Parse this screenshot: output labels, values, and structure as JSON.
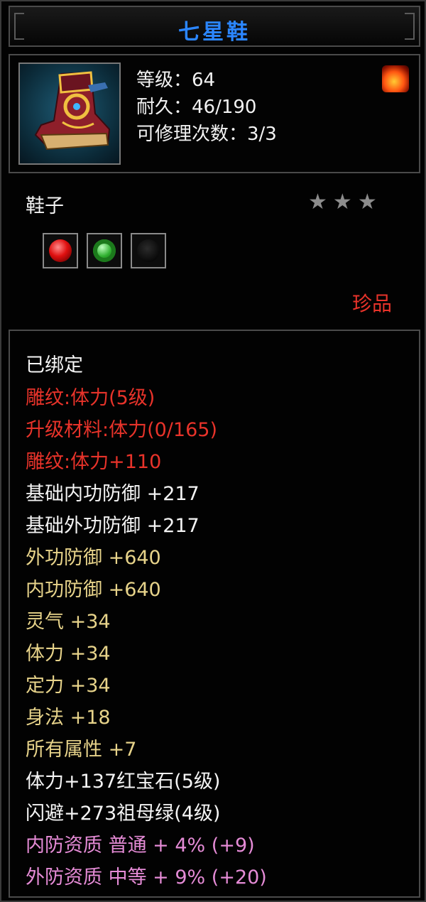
{
  "item": {
    "name": "七星鞋",
    "level_line": "等级：64",
    "durability_line": "耐久：46/190",
    "repair_line": "可修理次数：3/3",
    "type": "鞋子",
    "star_glyph": "★",
    "stars": 3,
    "quality": "珍品"
  },
  "icons": {
    "item_icon": "boots-icon",
    "fire_icon": "fire-element-icon",
    "gems": [
      "ruby-gem-icon",
      "emerald-gem-icon",
      "empty-gem-slot-icon"
    ]
  },
  "attributes": [
    {
      "text": "已绑定",
      "color": "#f4f4f4"
    },
    {
      "text": "雕纹:体力(5级)",
      "color": "#e8332a"
    },
    {
      "text": "升级材料:体力(0/165)",
      "color": "#e8332a"
    },
    {
      "text": "雕纹:体力+110",
      "color": "#e8332a"
    },
    {
      "text": "基础内功防御 +217",
      "color": "#f4f4f4"
    },
    {
      "text": "基础外功防御 +217",
      "color": "#f4f4f4"
    },
    {
      "text": "外功防御 +640",
      "color": "#e7d38a"
    },
    {
      "text": "内功防御 +640",
      "color": "#e7d38a"
    },
    {
      "text": "灵气 +34",
      "color": "#e7d38a"
    },
    {
      "text": "体力 +34",
      "color": "#e7d38a"
    },
    {
      "text": "定力 +34",
      "color": "#e7d38a"
    },
    {
      "text": "身法 +18",
      "color": "#e7d38a"
    },
    {
      "text": "所有属性 +7",
      "color": "#e7d38a"
    },
    {
      "text": "体力+137红宝石(5级)",
      "color": "#f4f4f4"
    },
    {
      "text": "闪避+273祖母绿(4级)",
      "color": "#f4f4f4"
    },
    {
      "text": "内防资质 普通 + 4% (+9)",
      "color": "#e58bd6"
    },
    {
      "text": "外防资质 中等 + 9% (+20)",
      "color": "#e58bd6"
    }
  ]
}
